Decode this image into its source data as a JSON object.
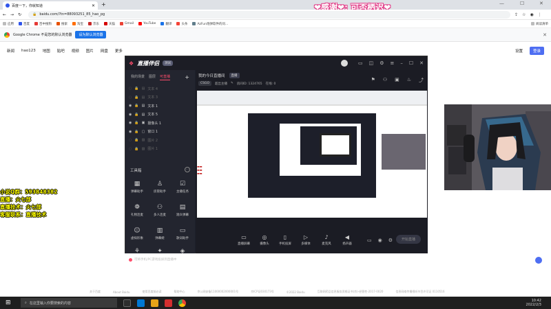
{
  "browser": {
    "tab_title": "百度一下，你就知道",
    "url": "baidu.com/?tn=88093251_85_hao_pg",
    "bookmarks": [
      "应用",
      "百度",
      "百中搜狗",
      "搜索",
      "淘宝",
      "京东",
      "天猫",
      "Gmail",
      "YouTube",
      "翻译",
      "头条",
      "AzFun炮弹软件的问..."
    ],
    "reading_list": "阅读清单",
    "infobar_text": "Google Chrome 不是您的默认浏览器",
    "infobar_button": "设为默认浏览器"
  },
  "banner_text": "❤感谢❤: 可否栖迟❤",
  "baidu_nav": {
    "left": [
      "新闻",
      "hao123",
      "地图",
      "贴吧",
      "视频",
      "图片",
      "网盘",
      "更多"
    ],
    "settings": "设置",
    "login": "登录"
  },
  "app": {
    "logo": "直播伴侣",
    "version_badge": "测试",
    "left_tabs": [
      "我的场景",
      "图层",
      "可直播"
    ],
    "layers": [
      {
        "name": "文本 4",
        "visible": false
      },
      {
        "name": "文本 3",
        "visible": false
      },
      {
        "name": "文本 1",
        "visible": true
      },
      {
        "name": "文本 5",
        "visible": true
      },
      {
        "name": "摄像头 1",
        "visible": true
      },
      {
        "name": "窗口 1",
        "visible": true
      },
      {
        "name": "图片 2",
        "visible": false
      },
      {
        "name": "图片 1",
        "visible": false
      }
    ],
    "tools_title": "工具箱",
    "tools": [
      "弹幕助手",
      "房管助手",
      "主播任务",
      "礼物连麦",
      "多人连麦",
      "观众弹幕",
      "虚拟形象",
      "弹幕姬",
      "歌词助手",
      "",
      "",
      ""
    ],
    "footer_hint": "可将手机/PC游戏投屏到直播中",
    "main_title": "我的今日直播间",
    "main_title_pill": "直播",
    "stats": [
      "CSGO",
      "超出主播",
      "房间ID: 1324765",
      "在线: 0"
    ],
    "controls": [
      "直播屏幕",
      "摄像头",
      "手机投屏",
      "多媒体",
      "麦克风",
      "扬声器"
    ],
    "start_button": "开始直播"
  },
  "overlay_lines": [
    "小说Q群：593848382",
    "直播：火七部",
    "直播技术：火七部",
    "客服联系：直播技术"
  ],
  "footer_links": [
    "关于百度",
    "About Baidu",
    "使用百度前必读",
    "帮助中心",
    "京公网安备11000002000001号",
    "京ICP证030173号",
    "©2022 Baidu",
    "互联网药品信息服务资格证书(京)-经营性-2017-0020",
    "信息网络传播视听节目许可证 0110516"
  ],
  "taskbar": {
    "search_placeholder": "在这里输入你要搜索的内容",
    "time": "10:42",
    "date": "2022/2/3"
  }
}
